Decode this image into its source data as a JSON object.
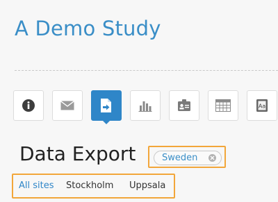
{
  "header": {
    "study_title": "A Demo Study"
  },
  "toolbar": {
    "items": [
      {
        "icon": "info-icon",
        "active": false
      },
      {
        "icon": "mail-icon",
        "active": false
      },
      {
        "icon": "export-document-icon",
        "active": true
      },
      {
        "icon": "bar-chart-icon",
        "active": false
      },
      {
        "icon": "id-card-icon",
        "active": false
      },
      {
        "icon": "table-icon",
        "active": false
      },
      {
        "icon": "font-document-icon",
        "active": false
      }
    ]
  },
  "main": {
    "title": "Data Export",
    "site_filter_pill": "Sweden"
  },
  "site_filter": {
    "options": [
      "All sites",
      "Stockholm",
      "Uppsala"
    ],
    "selected": "All sites"
  },
  "colors": {
    "accent": "#2f86c8",
    "title_blue": "#3a8ec7",
    "highlight": "#f2a63a"
  }
}
